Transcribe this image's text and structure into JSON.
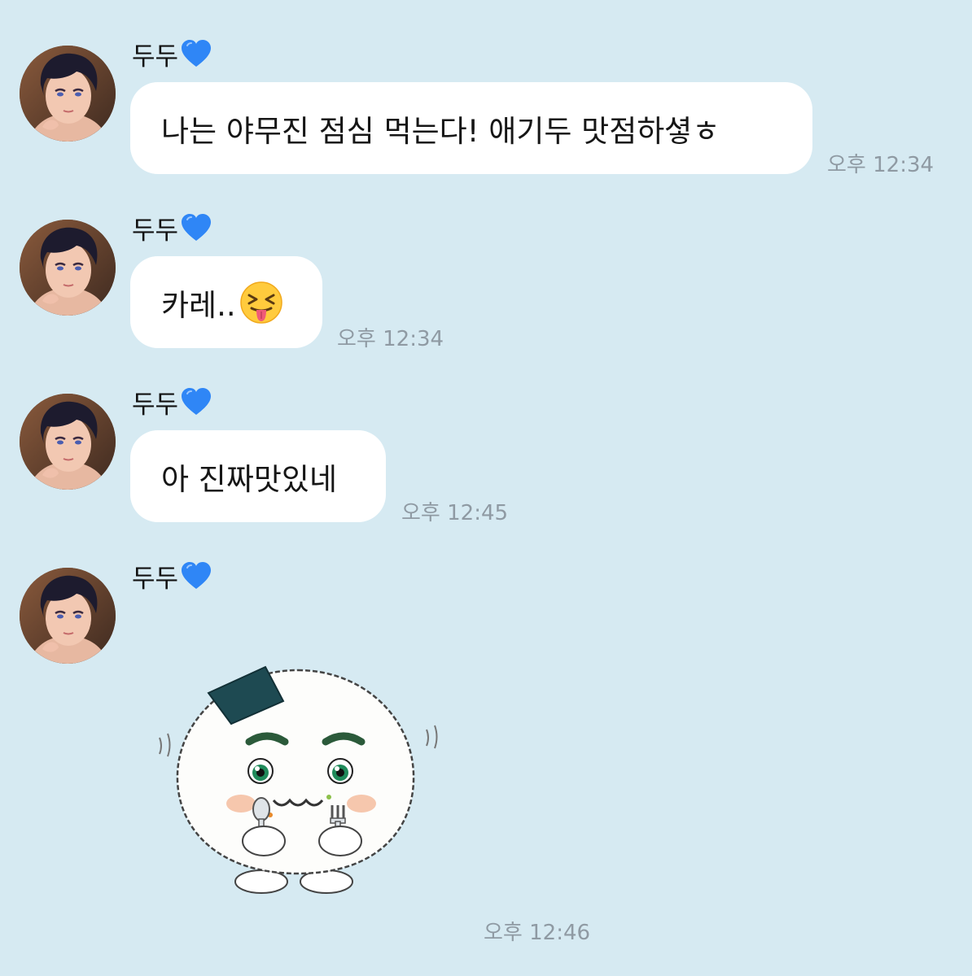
{
  "chat": {
    "sender_name": "두두",
    "sender_badge_icon": "blue-heart-icon",
    "accent_color": "#2f86f6",
    "messages": [
      {
        "type": "text",
        "text": "나는 야무진 점심 먹는다! 애기두 맛점하셯ㅎ",
        "time": "오후 12:34"
      },
      {
        "type": "text",
        "text": "카레..",
        "emoji": "squinting-tongue-face-icon",
        "time": "오후 12:34"
      },
      {
        "type": "text",
        "text": "아 진짜맛있네",
        "time": "오후 12:45"
      },
      {
        "type": "sticker",
        "sticker": "rice-ball-eating-sticker",
        "time": "오후 12:46"
      }
    ]
  }
}
